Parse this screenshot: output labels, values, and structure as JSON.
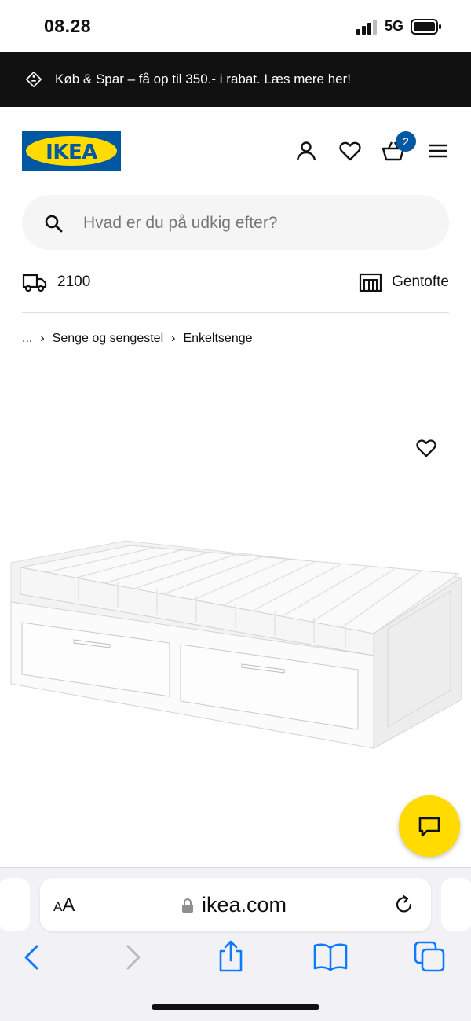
{
  "status_bar": {
    "time": "08.28",
    "network": "5G"
  },
  "promo": {
    "text": "Køb & Spar – få op til 350.- i rabat. Læs mere her!",
    "icon": "price-tag-icon"
  },
  "header": {
    "logo": "IKEA",
    "icons": [
      "user-icon",
      "heart-icon",
      "cart-icon",
      "menu-icon"
    ],
    "cart_count": "2"
  },
  "search": {
    "placeholder": "Hvad er du på udkig efter?"
  },
  "location": {
    "postcode": "2100",
    "store": "Gentofte"
  },
  "breadcrumb": {
    "ellipsis": "...",
    "items": [
      "Senge og sengestel",
      "Enkeltsenge"
    ]
  },
  "browser": {
    "aa_small": "A",
    "aa_big": "A",
    "domain": "ikea.com"
  },
  "colors": {
    "brand_blue": "#0058a3",
    "brand_yellow": "#ffdb00",
    "promo_bg": "#111111",
    "ios_blue": "#0a7aff"
  }
}
